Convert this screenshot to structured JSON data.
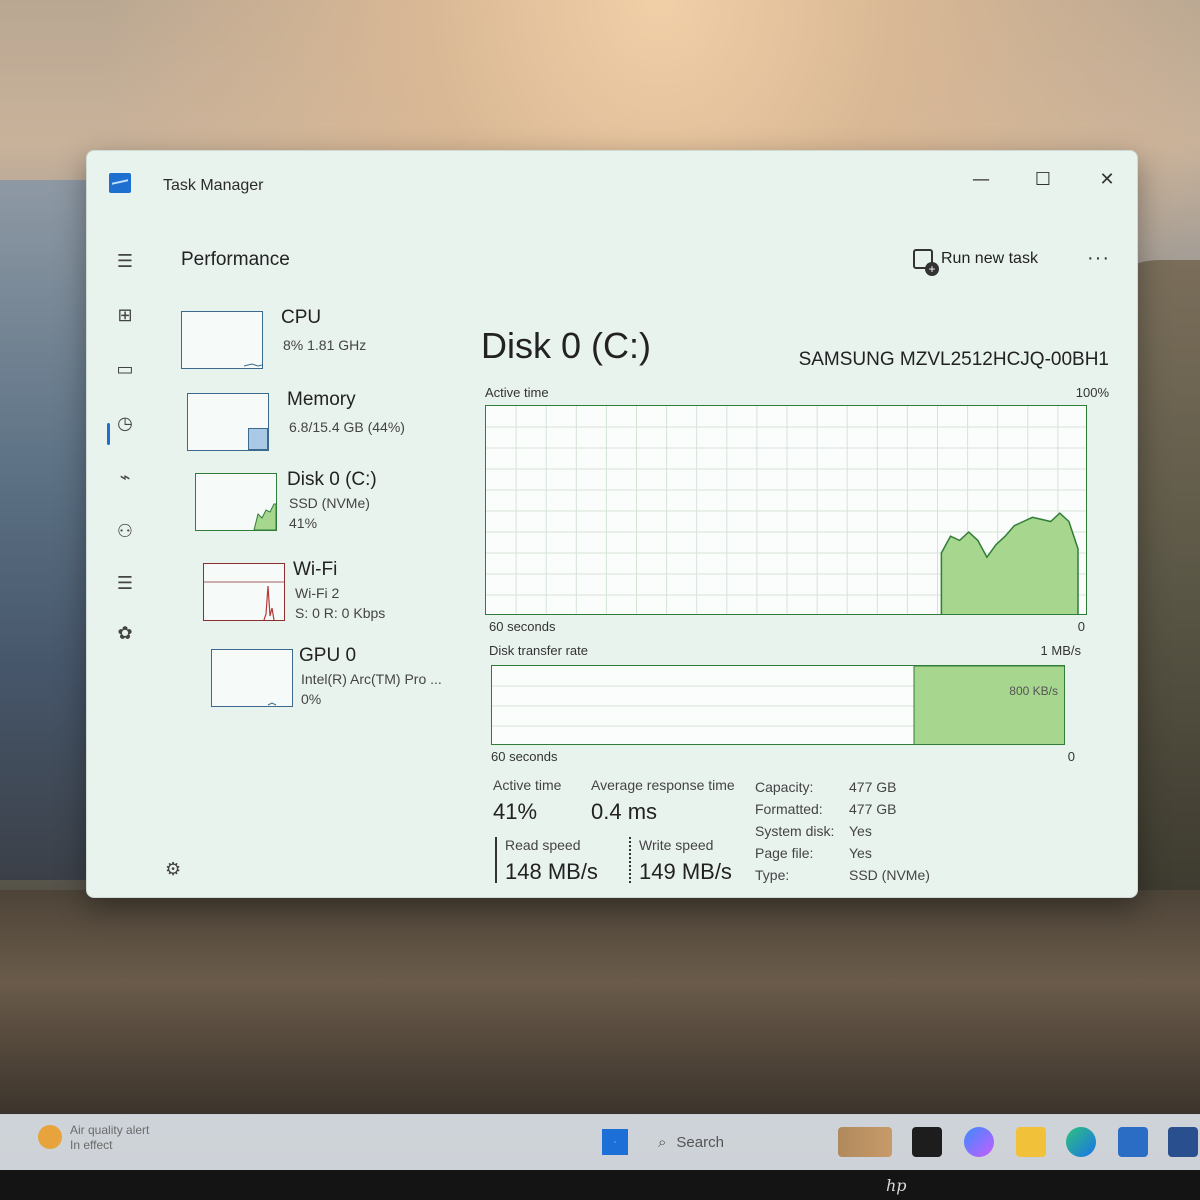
{
  "window": {
    "title": "Task Manager",
    "minimize": "—",
    "maximize": "☐",
    "close": "✕"
  },
  "header": {
    "page_title": "Performance",
    "run_task": "Run new task",
    "more": "···"
  },
  "devices": [
    {
      "name": "CPU",
      "line1": "8% 1.81 GHz",
      "line2": ""
    },
    {
      "name": "Memory",
      "line1": "6.8/15.4 GB (44%)",
      "line2": ""
    },
    {
      "name": "Disk 0 (C:)",
      "line1": "SSD (NVMe)",
      "line2": "41%"
    },
    {
      "name": "Wi-Fi",
      "line1": "Wi-Fi 2",
      "line2": "S: 0 R: 0 Kbps"
    },
    {
      "name": "GPU 0",
      "line1": "Intel(R) Arc(TM) Pro ...",
      "line2": "0%"
    }
  ],
  "detail": {
    "title": "Disk 0 (C:)",
    "model": "SAMSUNG MZVL2512HCJQ-00BH1",
    "active_time_label": "Active time",
    "active_time_max": "100%",
    "active_time_xleft": "60 seconds",
    "active_time_xright": "0",
    "transfer_label": "Disk transfer rate",
    "transfer_max": "1 MB/s",
    "transfer_mark": "800 KB/s",
    "transfer_xleft": "60 seconds",
    "transfer_xright": "0"
  },
  "stats": {
    "active_time_label": "Active time",
    "active_time_value": "41%",
    "avg_resp_label": "Average response time",
    "avg_resp_value": "0.4 ms",
    "read_label": "Read speed",
    "read_value": "148 MB/s",
    "write_label": "Write speed",
    "write_value": "149 MB/s"
  },
  "properties": [
    {
      "key": "Capacity:",
      "value": "477 GB"
    },
    {
      "key": "Formatted:",
      "value": "477 GB"
    },
    {
      "key": "System disk:",
      "value": "Yes"
    },
    {
      "key": "Page file:",
      "value": "Yes"
    },
    {
      "key": "Type:",
      "value": "SSD (NVMe)"
    }
  ],
  "taskbar": {
    "alert_line1": "Air quality alert",
    "alert_line2": "In effect",
    "search_placeholder": "Search"
  },
  "colors": {
    "disk_fill": "#a7d68f",
    "disk_line": "#2f7d36",
    "accent": "#1e6fcf"
  },
  "active_time_series": [
    0,
    0,
    0,
    0,
    0,
    0,
    0,
    0,
    0,
    0,
    0,
    0,
    0,
    0,
    0,
    0,
    0,
    0,
    0,
    0,
    0,
    0,
    0,
    0,
    0,
    0,
    0,
    0,
    0,
    0,
    0,
    0,
    0,
    0,
    0,
    0,
    0,
    0,
    0,
    0,
    0,
    0,
    0,
    0,
    0,
    0,
    0,
    0,
    0,
    0,
    30,
    38,
    36,
    40,
    36,
    28,
    34,
    38,
    43,
    45,
    47,
    46,
    45,
    49,
    45,
    32
  ]
}
